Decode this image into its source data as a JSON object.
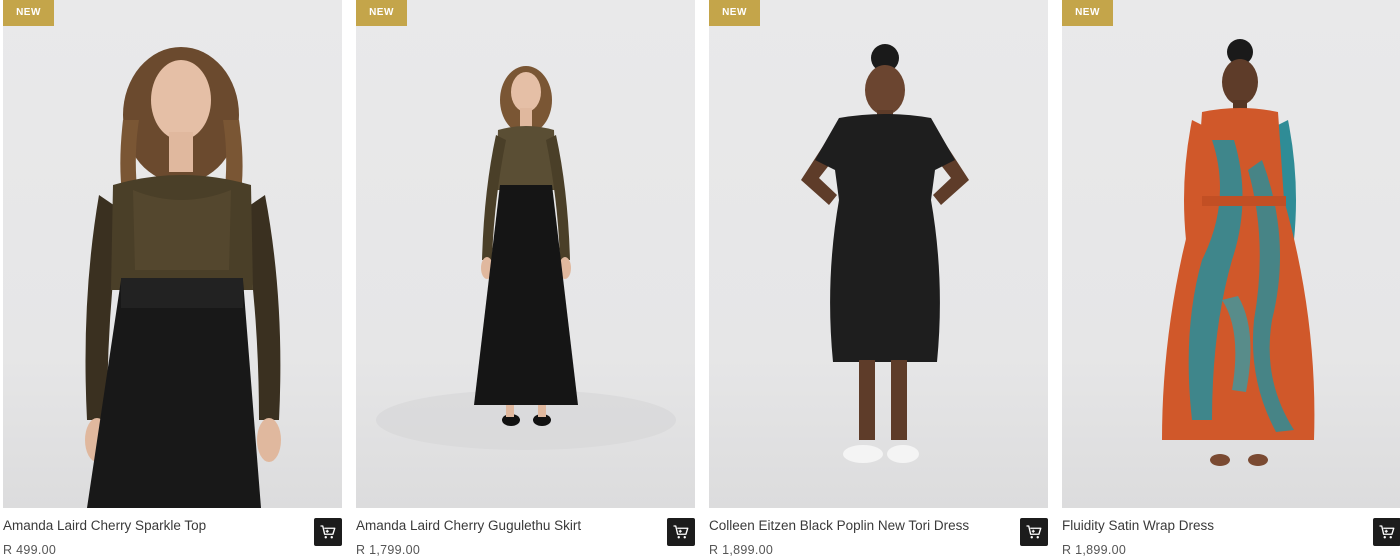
{
  "products": [
    {
      "badge": "NEW",
      "name": "Amanda Laird Cherry Sparkle Top",
      "price": "R 499.00",
      "image_icon": "model-photo"
    },
    {
      "badge": "NEW",
      "name": "Amanda Laird Cherry Gugulethu Skirt",
      "price": "R 1,799.00",
      "image_icon": "model-photo"
    },
    {
      "badge": "NEW",
      "name": "Colleen Eitzen Black Poplin New Tori Dress",
      "price": "R 1,899.00",
      "image_icon": "model-photo"
    },
    {
      "badge": "NEW",
      "name": "Fluidity Satin Wrap Dress",
      "price": "R 1,899.00",
      "image_icon": "model-photo"
    }
  ],
  "colors": {
    "badge": "#c4a54a",
    "cart_button": "#1c1c1c",
    "photo_background": "#e7e7e8"
  },
  "cart_icon": "add-to-cart-icon"
}
